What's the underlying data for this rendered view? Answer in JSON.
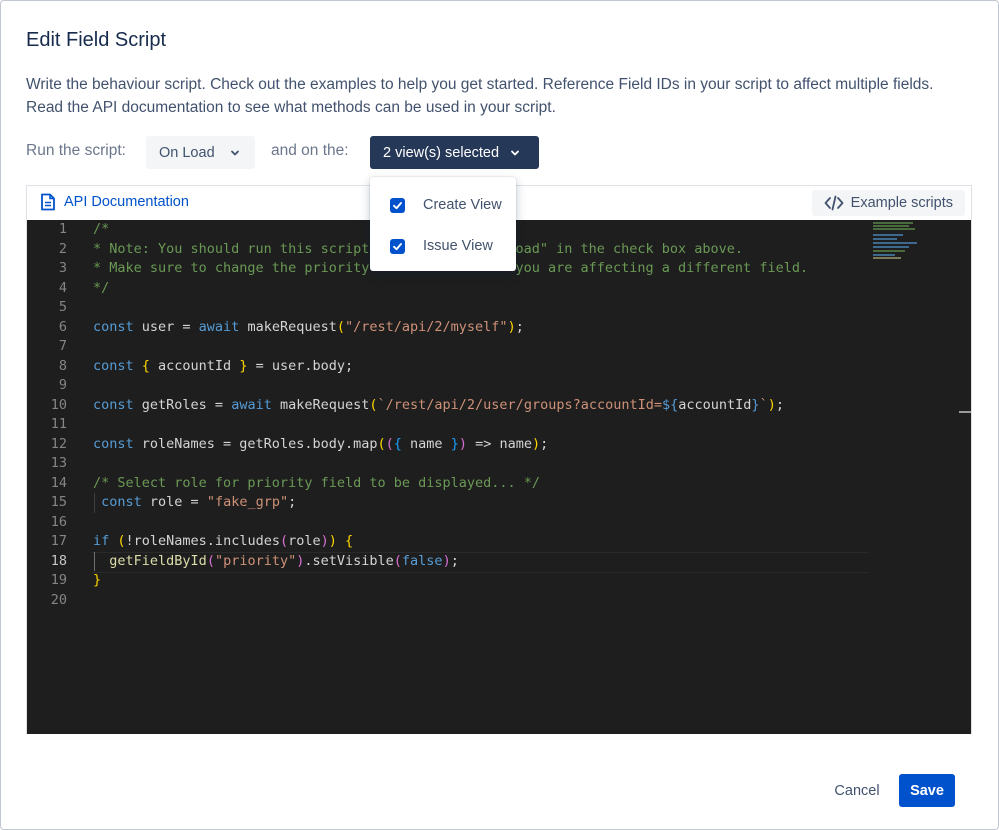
{
  "dialog": {
    "title": "Edit Field Script",
    "description": "Write the behaviour script. Check out the examples to help you get started. Reference Field IDs in your script to affect multiple fields. Read the API documentation to see what methods can be used in your script."
  },
  "run": {
    "label_run": "Run the script:",
    "trigger_value": "On Load",
    "label_views": "and on the:",
    "views_value": "2 view(s) selected"
  },
  "views_menu": {
    "options": [
      {
        "label": "Create View",
        "checked": true
      },
      {
        "label": "Issue View",
        "checked": true
      }
    ]
  },
  "editor": {
    "api_doc_label": "API Documentation",
    "example_scripts_label": "Example scripts",
    "active_line": 18,
    "line_numbers": [
      "1",
      "2",
      "3",
      "4",
      "5",
      "6",
      "7",
      "8",
      "9",
      "10",
      "11",
      "12",
      "13",
      "14",
      "15",
      "16",
      "17",
      "18",
      "19",
      "20"
    ],
    "lines": {
      "l1": "/*",
      "l2a": "* Note: You should run this script ",
      "l2b": "oad\" in the check box above.",
      "l3a": "* Make sure to change the priority ",
      "l3b": "you are affecting a different field.",
      "l4": "*/",
      "l6_kw": "const",
      "l6_var": " user = ",
      "l6_kw2": "await",
      "l6_fn": " makeRequest",
      "l6_open": "(",
      "l6_str": "\"/rest/api/2/myself\"",
      "l6_close": ")",
      "l6_end": ";",
      "l8_kw": "const",
      "l8_open": " {",
      "l8_mid": " accountId ",
      "l8_close": "}",
      "l8_end": " = user.body;",
      "l10_kw": "const",
      "l10_var": " getRoles = ",
      "l10_kw2": "await",
      "l10_fn": " makeRequest",
      "l10_open": "(",
      "l10_str1": "`/rest/api/2/user/groups?accountId=",
      "l10_tpl_open": "${",
      "l10_tpl_var": "accountId",
      "l10_tpl_close": "}",
      "l10_str2": "`",
      "l10_close": ")",
      "l10_end": ";",
      "l12_kw": "const",
      "l12_var": " roleNames = getRoles.body.map",
      "l12_open1": "(",
      "l12_open2": "(",
      "l12_open3": "{",
      "l12_name": " name ",
      "l12_close3": "}",
      "l12_close2": ")",
      "l12_arrow": " => name",
      "l12_close1": ")",
      "l12_end": ";",
      "l14": "/* Select role for priority field to be displayed... */",
      "l15_kw": "const",
      "l15_var": " role = ",
      "l15_str": "\"fake_grp\"",
      "l15_end": ";",
      "l17_kw": "if",
      "l17_open": " (",
      "l17_mid": "!roleNames.includes",
      "l17_open2": "(",
      "l17_arg": "role",
      "l17_close2": ")",
      "l17_close": ")",
      "l17_brace": " {",
      "l18_fn": "getFieldById",
      "l18_open": "(",
      "l18_str": "\"priority\"",
      "l18_close": ")",
      "l18_mid": ".setVisible",
      "l18_open2": "(",
      "l18_kw": "false",
      "l18_close2": ")",
      "l18_end": ";",
      "l19": "}"
    }
  },
  "footer": {
    "cancel_label": "Cancel",
    "save_label": "Save"
  },
  "colors": {
    "primary": "#0052cc",
    "dark_button": "#253858",
    "editor_bg": "#1e1e1e",
    "comment": "#6a9955",
    "keyword": "#569cd6",
    "string": "#ce9178"
  }
}
